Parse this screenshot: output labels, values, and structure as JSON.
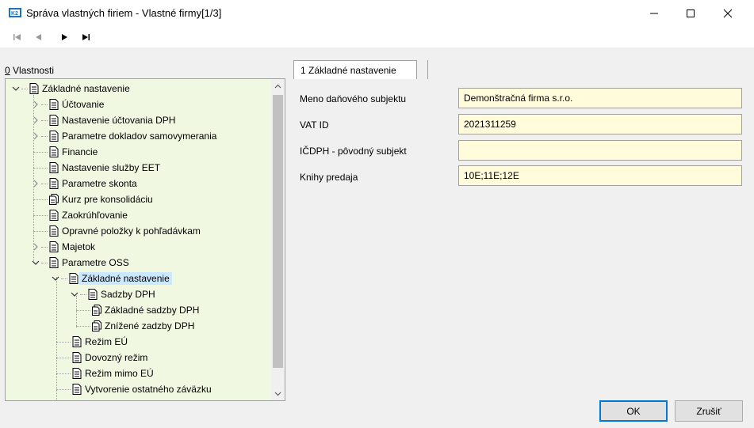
{
  "window": {
    "title": "Správa vlastných firiem - Vlastné firmy[1/3]"
  },
  "toolbar": {
    "first_icon": "first-record-icon",
    "prev_icon": "previous-record-icon",
    "next_icon": "next-record-icon",
    "last_icon": "last-record-icon"
  },
  "properties": {
    "label_prefix": "0",
    "label_rest": " Vlastnosti"
  },
  "tree": {
    "items": [
      {
        "label": "Základné nastavenie"
      },
      {
        "label": "Účtovanie"
      },
      {
        "label": "Nastavenie účtovania DPH"
      },
      {
        "label": "Parametre dokladov samovymerania"
      },
      {
        "label": "Financie"
      },
      {
        "label": "Nastavenie služby EET"
      },
      {
        "label": "Parametre skonta"
      },
      {
        "label": "Kurz pre konsolidáciu"
      },
      {
        "label": "Zaokrúhľovanie"
      },
      {
        "label": "Opravné položky k pohľadávkam"
      },
      {
        "label": "Majetok"
      },
      {
        "label": "Parametre OSS"
      },
      {
        "label": "Základné nastavenie"
      },
      {
        "label": "Sadzby DPH"
      },
      {
        "label": "Základné sadzby DPH"
      },
      {
        "label": "Znížené zadzby DPH"
      },
      {
        "label": "Režim EÚ"
      },
      {
        "label": "Dovozný režim"
      },
      {
        "label": "Režim mimo EÚ"
      },
      {
        "label": "Vytvorenie ostatného záväzku"
      }
    ]
  },
  "tab": {
    "label": "1 Základné nastavenie"
  },
  "form": {
    "fields": [
      {
        "label": "Meno daňového subjektu",
        "value": "Demonštračná firma s.r.o."
      },
      {
        "label": "VAT ID",
        "value": "2021311259"
      },
      {
        "label": "IČDPH - pôvodný subjekt",
        "value": ""
      },
      {
        "label": "Knihy predaja",
        "value": "10E;11E;12E"
      }
    ]
  },
  "buttons": {
    "ok": "OK",
    "cancel": "Zrušiť"
  },
  "colors": {
    "tree_bg": "#f0f8e2",
    "field_bg": "#fffbdb",
    "selection": "#cce8ff",
    "default_button_border": "#0078d7"
  }
}
